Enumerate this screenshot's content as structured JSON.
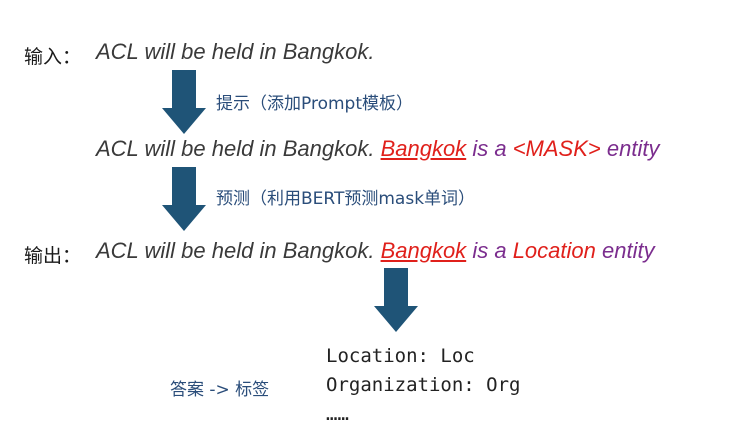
{
  "input": {
    "label": "输入：",
    "sentence": "ACL will be held in Bangkok."
  },
  "step1": {
    "note": "提示（添加Prompt模板）"
  },
  "prompt": {
    "sentence": "ACL will be held in Bangkok.",
    "entity": "Bangkok",
    "is_a": "is a",
    "mask": "<MASK>",
    "suffix": "entity"
  },
  "step2": {
    "note": "预测（利用BERT预测mask单词）"
  },
  "output": {
    "label": "输出：",
    "sentence": "ACL will be held in Bangkok.",
    "entity": "Bangkok",
    "is_a": "is a",
    "prediction": "Location",
    "suffix": "entity"
  },
  "answer_mapping": {
    "label": "答案 -> 标签",
    "lines": [
      "Location: Loc",
      "Organization: Org",
      "……"
    ]
  },
  "colors": {
    "arrow": "#1f5477",
    "entity_red": "#e0201b",
    "purple": "#7b2d8e",
    "note_blue": "#2a4d7a"
  }
}
